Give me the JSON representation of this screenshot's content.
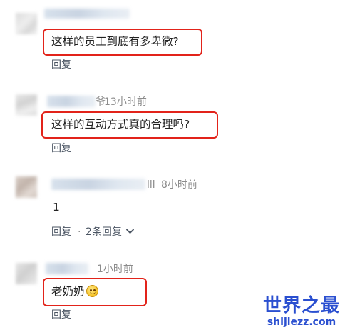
{
  "comments": [
    {
      "time": "",
      "text": "这样的员工到底有多卑微?",
      "actions": {
        "reply": "回复"
      }
    },
    {
      "name_tail": "爷",
      "time": "13小时前",
      "text": "这样的互动方式真的合理吗?",
      "actions": {
        "reply": "回复"
      }
    },
    {
      "name_tail": "lll",
      "time": "8小时前",
      "text": "1",
      "actions": {
        "reply": "回复",
        "separator": "·",
        "replies_count": "2条回复"
      }
    },
    {
      "time": "1小时前",
      "text": "老奶奶",
      "emoji": "smiling-face-emoji",
      "actions": {
        "reply": "回复"
      }
    }
  ],
  "watermark": {
    "title": "世界之最",
    "url": "shijiezz.com"
  },
  "colors": {
    "highlight_box": "#e2231a",
    "watermark": "#2a4fd0",
    "time_text": "#8c8c8c",
    "action_text": "#4b5563"
  }
}
